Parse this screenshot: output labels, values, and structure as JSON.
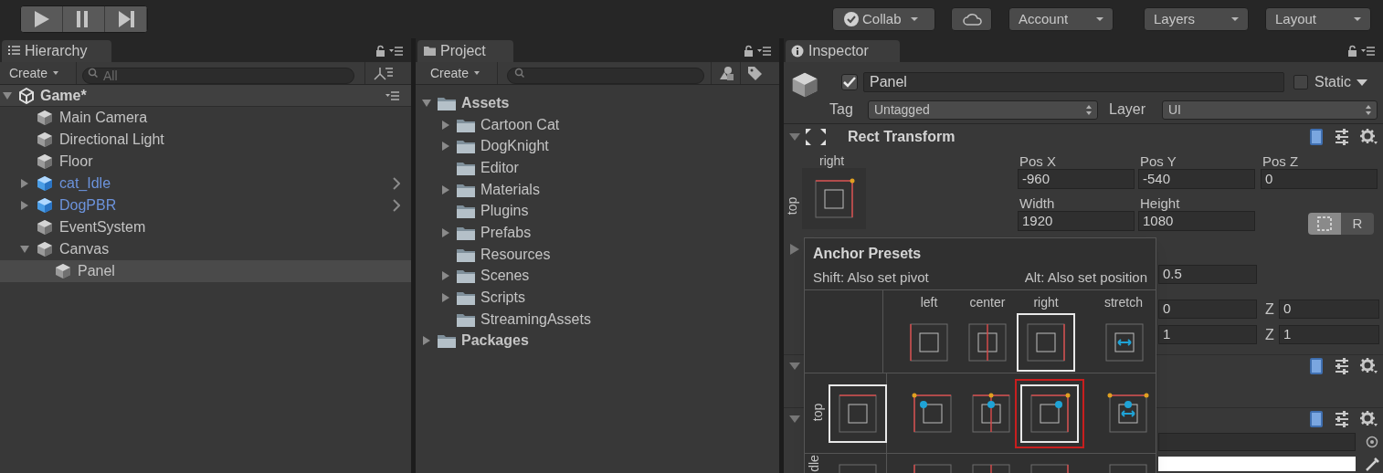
{
  "toolbar": {
    "buttons": [
      {
        "kind": "collab",
        "label": "Collab"
      },
      {
        "kind": "cloud"
      },
      {
        "kind": "dropdown",
        "label": "Account"
      },
      {
        "kind": "dropdown",
        "label": "Layers"
      },
      {
        "kind": "dropdown",
        "label": "Layout"
      }
    ]
  },
  "hierarchy": {
    "tab": "Hierarchy",
    "create": "Create",
    "search_placeholder": "All",
    "scene": {
      "name": "Game*",
      "expanded": true,
      "children": [
        {
          "name": "Main Camera",
          "kind": "object",
          "selected": false
        },
        {
          "name": "Directional Light",
          "kind": "object",
          "selected": false
        },
        {
          "name": "Floor",
          "kind": "object",
          "selected": false
        },
        {
          "name": "cat_Idle",
          "kind": "prefab",
          "selected": false,
          "expanded": false
        },
        {
          "name": "DogPBR",
          "kind": "prefab",
          "selected": false,
          "expanded": false
        },
        {
          "name": "EventSystem",
          "kind": "object",
          "selected": false
        },
        {
          "name": "Canvas",
          "kind": "object",
          "selected": false,
          "expanded": true,
          "children": [
            {
              "name": "Panel",
              "kind": "object",
              "selected": true
            }
          ]
        }
      ]
    }
  },
  "project": {
    "tab": "Project",
    "create": "Create",
    "tree": [
      {
        "name": "Assets",
        "selected": false,
        "expanded": true,
        "children": [
          {
            "name": "Cartoon Cat",
            "selected": false,
            "expanded": false
          },
          {
            "name": "DogKnight",
            "selected": false,
            "expanded": false
          },
          {
            "name": "Editor",
            "selected": false
          },
          {
            "name": "Materials",
            "selected": false,
            "expanded": false
          },
          {
            "name": "Plugins",
            "selected": false
          },
          {
            "name": "Prefabs",
            "selected": false,
            "expanded": false
          },
          {
            "name": "Resources",
            "selected": false
          },
          {
            "name": "Scenes",
            "selected": false,
            "expanded": false
          },
          {
            "name": "Scripts",
            "selected": false,
            "expanded": false
          },
          {
            "name": "StreamingAssets",
            "selected": false
          }
        ]
      },
      {
        "name": "Packages",
        "selected": false,
        "expanded": false
      }
    ]
  },
  "inspector": {
    "tab": "Inspector",
    "active": true,
    "name": "Panel",
    "static": false,
    "static_label": "Static",
    "tag_label": "Tag",
    "tag": "Untagged",
    "layer_label": "Layer",
    "layer": "UI",
    "rect_transform": {
      "title": "Rect Transform",
      "expanded": true,
      "anchor": {
        "kind": "top-right"
      },
      "anchor_h_label": "right",
      "anchor_v_label": "top",
      "fields": [
        {
          "label": "Pos X",
          "value": "-960"
        },
        {
          "label": "Pos Y",
          "value": "-540"
        },
        {
          "label": "Pos Z",
          "value": "0"
        },
        {
          "label": "Width",
          "value": "1920"
        },
        {
          "label": "Height",
          "value": "1080"
        }
      ],
      "blueprint_mode": true,
      "raw_button": "R"
    },
    "rows": [
      {
        "kind": "foldout",
        "expanded": false
      },
      {
        "kind": "fields",
        "fields": [
          {
            "value": "0.5"
          }
        ]
      },
      {
        "kind": "fields",
        "fields": [
          {
            "value": "0"
          },
          {
            "label": "Z",
            "value": "0"
          }
        ]
      },
      {
        "kind": "fields",
        "fields": [
          {
            "value": "1"
          },
          {
            "label": "Z",
            "value": "1"
          }
        ]
      },
      {
        "kind": "component",
        "expanded": true
      },
      {
        "kind": "component",
        "expanded": true
      },
      {
        "kind": "object_field"
      },
      {
        "kind": "color_field",
        "color": "#ffffff"
      }
    ],
    "anchor_presets": {
      "title": "Anchor Presets",
      "hint_left": "Shift: Also set pivot",
      "hint_right": "Alt: Also set position",
      "columns": [
        "left",
        "center",
        "right",
        "stretch"
      ],
      "rows": [
        {
          "kind": "none",
          "cells": [
            {
              "kind": "left",
              "highlighted": false,
              "selected": false
            },
            {
              "kind": "center",
              "highlighted": false,
              "selected": false
            },
            {
              "kind": "right",
              "highlighted": true,
              "selected": false
            },
            {
              "kind": "stretch",
              "highlighted": false,
              "selected": false
            }
          ]
        },
        {
          "kind": "top",
          "label": "top",
          "row_icon": {
            "highlighted": true
          },
          "cells": [
            {
              "kind": "left",
              "highlighted": false,
              "selected": false
            },
            {
              "kind": "center",
              "highlighted": false,
              "selected": false
            },
            {
              "kind": "right",
              "highlighted": true,
              "selected": true
            },
            {
              "kind": "stretch",
              "highlighted": false,
              "selected": false
            }
          ]
        },
        {
          "kind": "middle",
          "label": "dle",
          "row_icon": {
            "highlighted": false
          },
          "cells": [
            {
              "kind": "left",
              "highlighted": false,
              "selected": false
            },
            {
              "kind": "center",
              "highlighted": false,
              "selected": false
            },
            {
              "kind": "right",
              "highlighted": false,
              "selected": false
            },
            {
              "kind": "stretch",
              "highlighted": false,
              "selected": false
            }
          ]
        }
      ]
    }
  }
}
